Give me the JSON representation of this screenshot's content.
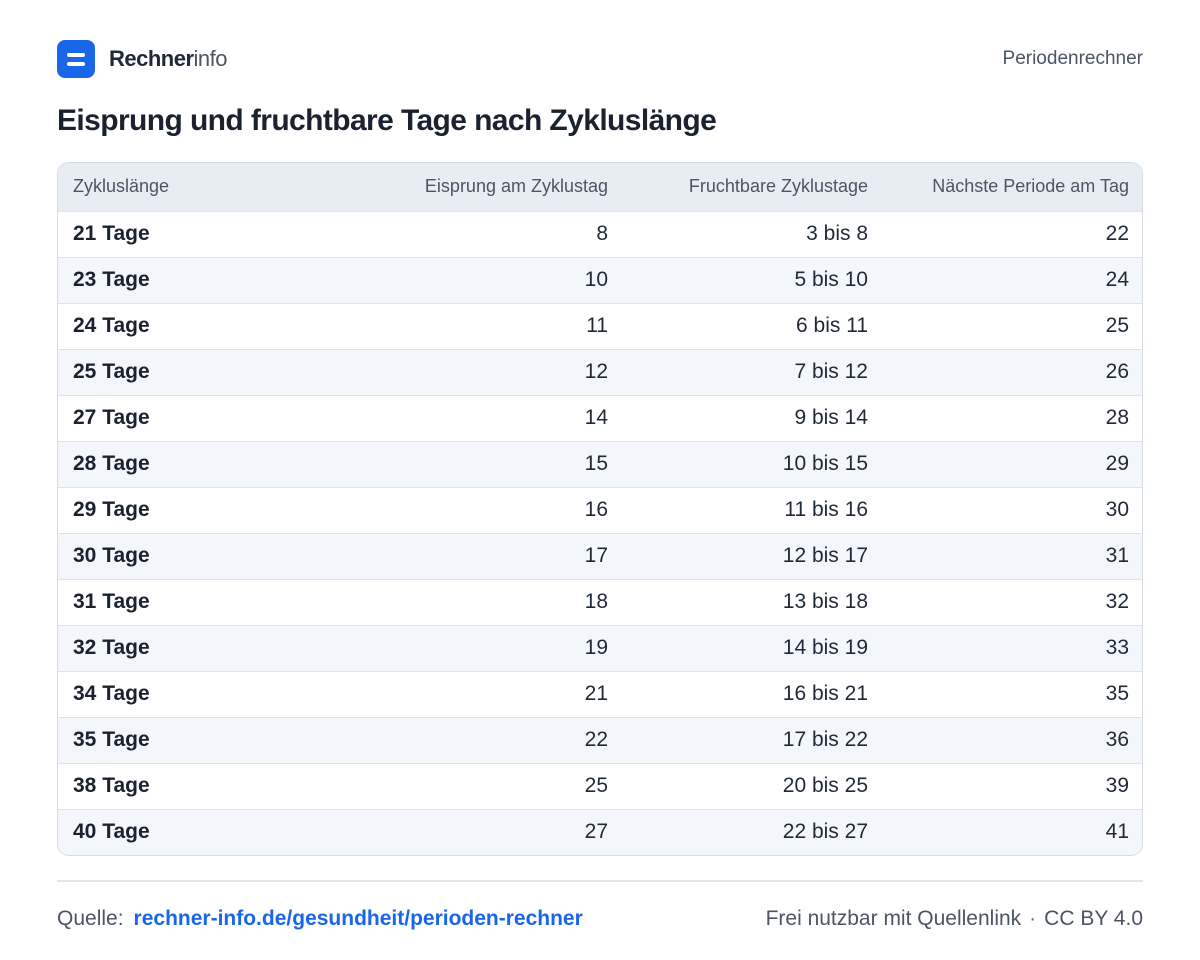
{
  "brand": {
    "name_bold": "Rechner",
    "name_light": "info"
  },
  "header": {
    "link": "Periodenrechner"
  },
  "title": "Eisprung und fruchtbare Tage nach Zykluslänge",
  "table": {
    "headers": [
      "Zykluslänge",
      "Eisprung am Zyklustag",
      "Fruchtbare Zyklustage",
      "Nächste Periode am Tag"
    ],
    "rows": [
      [
        "21 Tage",
        "8",
        "3 bis 8",
        "22"
      ],
      [
        "23 Tage",
        "10",
        "5 bis 10",
        "24"
      ],
      [
        "24 Tage",
        "11",
        "6 bis 11",
        "25"
      ],
      [
        "25 Tage",
        "12",
        "7 bis 12",
        "26"
      ],
      [
        "27 Tage",
        "14",
        "9 bis 14",
        "28"
      ],
      [
        "28 Tage",
        "15",
        "10 bis 15",
        "29"
      ],
      [
        "29 Tage",
        "16",
        "11 bis 16",
        "30"
      ],
      [
        "30 Tage",
        "17",
        "12 bis 17",
        "31"
      ],
      [
        "31 Tage",
        "18",
        "13 bis 18",
        "32"
      ],
      [
        "32 Tage",
        "19",
        "14 bis 19",
        "33"
      ],
      [
        "34 Tage",
        "21",
        "16 bis 21",
        "35"
      ],
      [
        "35 Tage",
        "22",
        "17 bis 22",
        "36"
      ],
      [
        "38 Tage",
        "25",
        "20 bis 25",
        "39"
      ],
      [
        "40 Tage",
        "27",
        "22 bis 27",
        "41"
      ]
    ]
  },
  "footer": {
    "source_label": "Quelle:",
    "source_link": "rechner-info.de/gesundheit/perioden-rechner",
    "license_text": "Frei nutzbar mit Quellenlink",
    "separator": "·",
    "license": "CC BY 4.0"
  },
  "colors": {
    "accent": "#1a66e8",
    "header_bg": "#e8edf4",
    "row_alt": "#f3f6fa"
  }
}
